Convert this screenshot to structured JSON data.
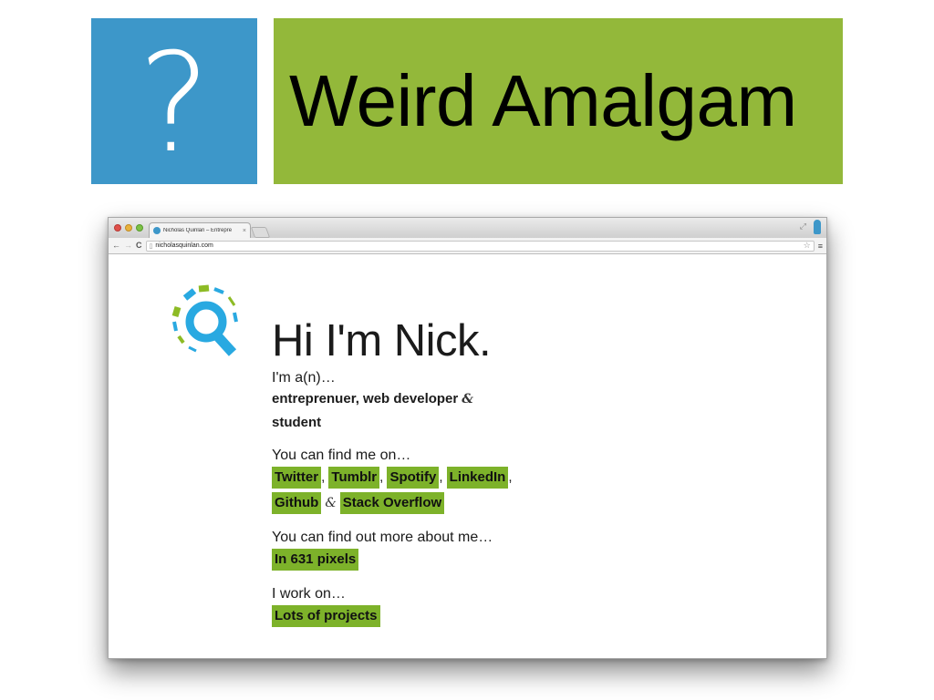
{
  "slide": {
    "icon_glyph": "?",
    "title": "Weird Amalgam"
  },
  "browser": {
    "tab": {
      "title": "Nicholas Quinlan – Entrepre",
      "close": "×"
    },
    "toolbar": {
      "back": "←",
      "forward": "→",
      "reload": "C",
      "url": "nicholasquinlan.com",
      "star": "☆",
      "menu": "≡"
    },
    "fullscreen": "⤢"
  },
  "page": {
    "heading": "Hi I'm Nick.",
    "intro": "I'm a(n)…",
    "roles_line1": "entreprenuer, web developer",
    "ampersand": "&",
    "roles_line2": "student",
    "find_me_label": "You can find me on…",
    "links_row1": [
      "Twitter",
      "Tumblr",
      "Spotify",
      "LinkedIn"
    ],
    "comma": ",",
    "links_row2": [
      "Github",
      "Stack Overflow"
    ],
    "more_label": "You can find out more about me…",
    "more_link": "In 631 pixels",
    "work_label": "I work on…",
    "work_link": "Lots of projects"
  },
  "colors": {
    "slide_blue": "#3d97c9",
    "slide_green": "#93b83a",
    "link_green": "#7db22a",
    "logo_blue": "#29a9e1",
    "logo_green": "#8dbb25"
  },
  "icons": {
    "logo": "q-logo-icon",
    "favicon": "q-favicon-icon",
    "profile": "profile-icon"
  }
}
